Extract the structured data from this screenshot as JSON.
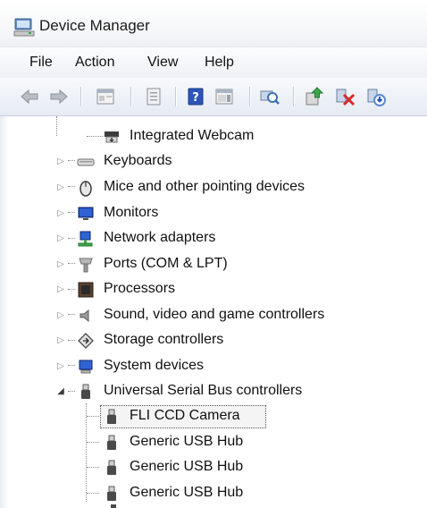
{
  "window": {
    "title": "Device Manager"
  },
  "menu": {
    "file": "File",
    "action": "Action",
    "view": "View",
    "help": "Help"
  },
  "toolbar": {
    "icons": [
      "back-arrow-icon",
      "forward-arrow-icon",
      "properties-icon",
      "update-view-icon",
      "help-icon",
      "action-pane-icon",
      "scan-hardware-icon",
      "update-driver-icon",
      "disable-device-icon",
      "uninstall-device-icon"
    ]
  },
  "tree": {
    "webcam": "Integrated Webcam",
    "keyboards": "Keyboards",
    "mice": "Mice and other pointing devices",
    "monitors": "Monitors",
    "network": "Network adapters",
    "ports": "Ports (COM & LPT)",
    "processors": "Processors",
    "sound": "Sound, video and game controllers",
    "storage": "Storage controllers",
    "system": "System devices",
    "usb": "Universal Serial Bus controllers",
    "usb_children": [
      "FLI CCD Camera",
      "Generic USB Hub",
      "Generic USB Hub",
      "Generic USB Hub"
    ],
    "selected_item": "FLI CCD Camera"
  }
}
